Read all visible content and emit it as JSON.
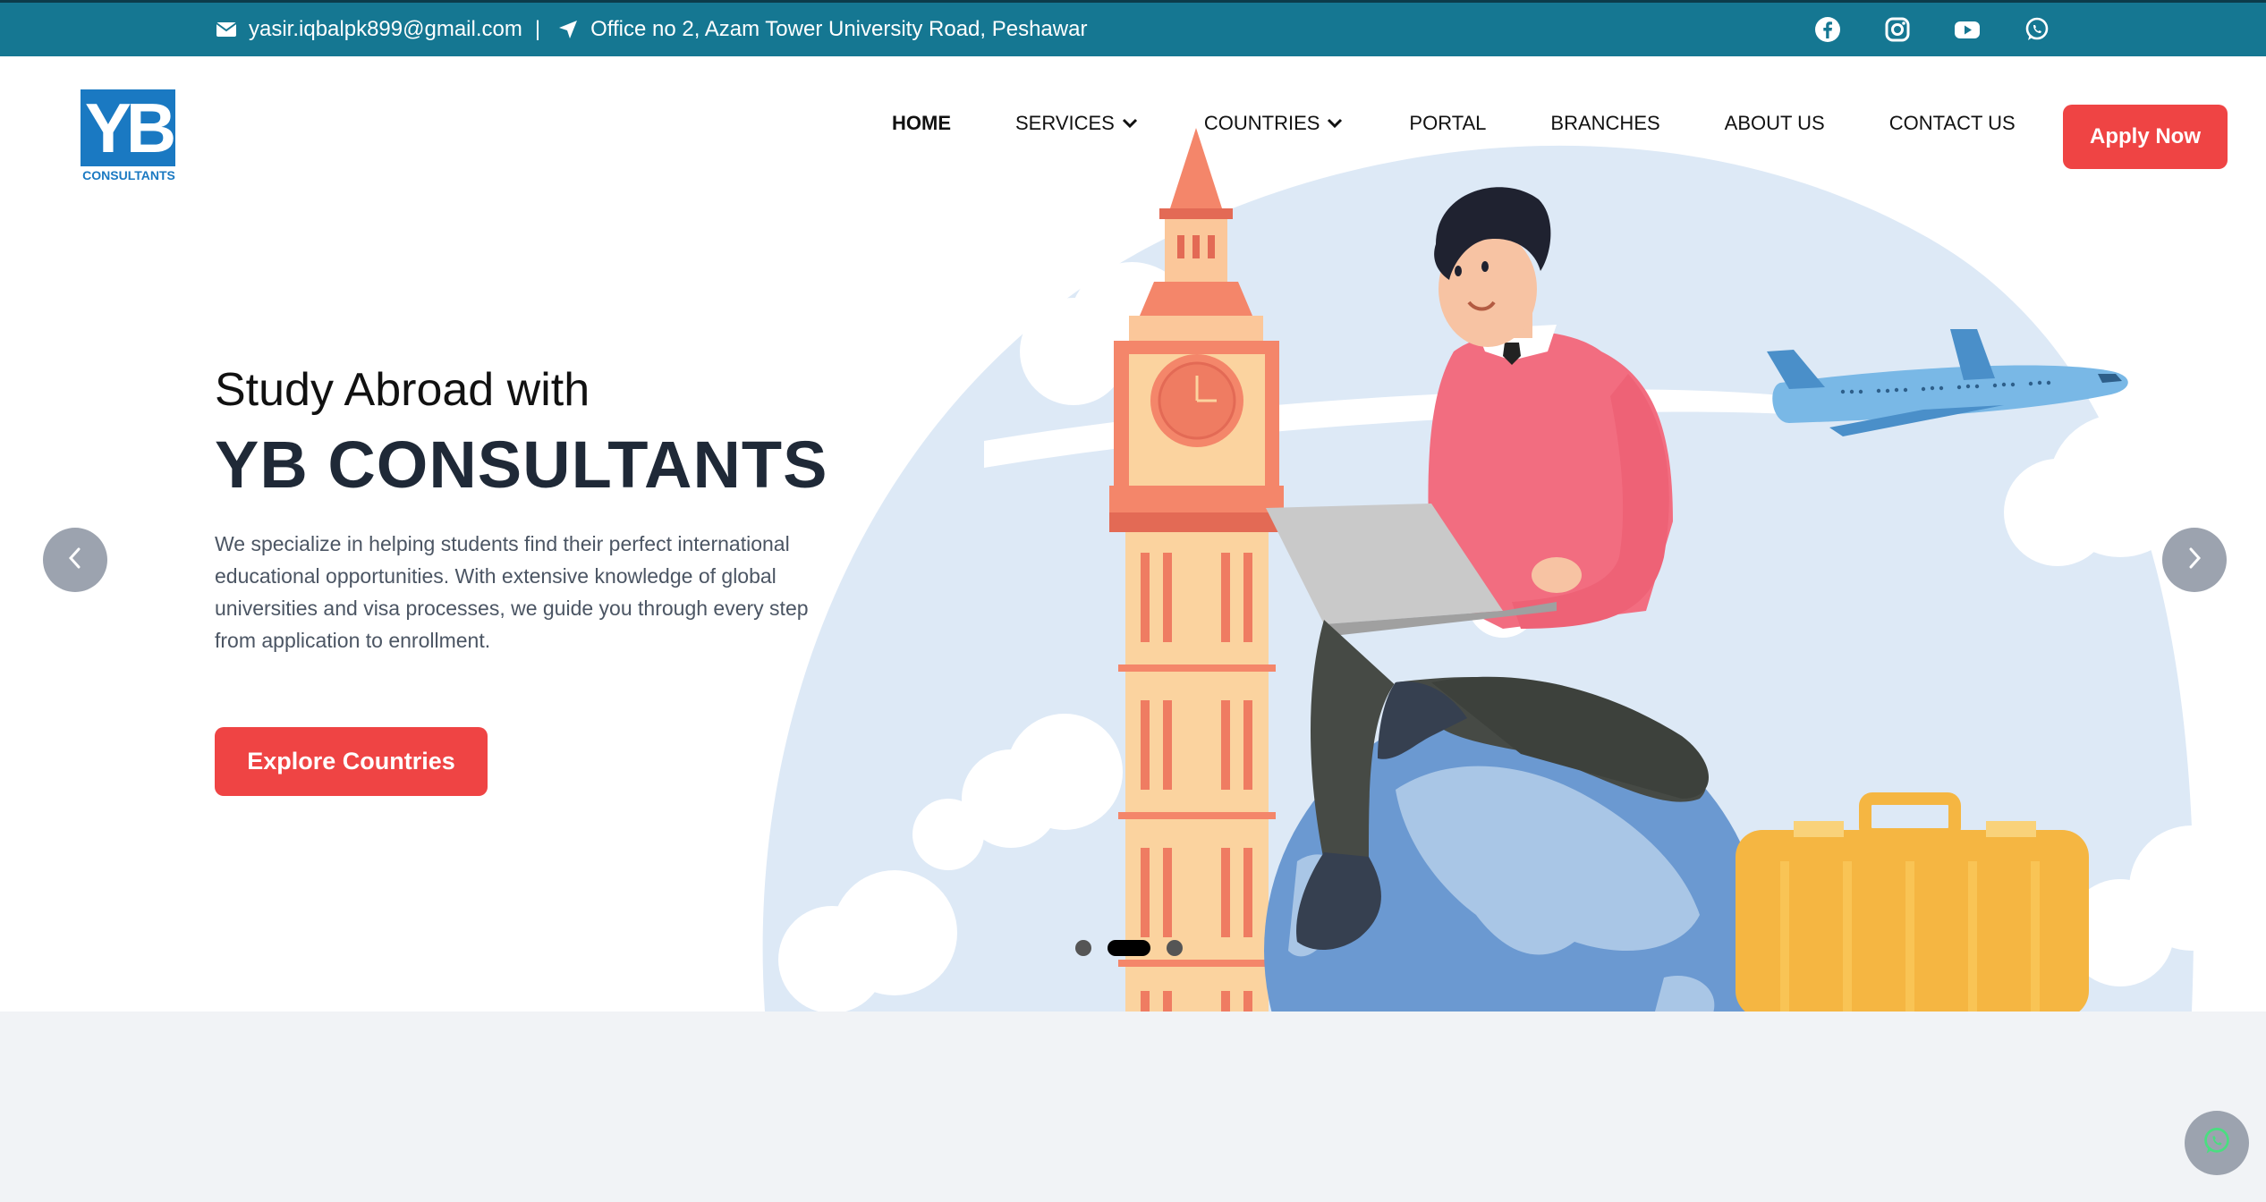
{
  "topbar": {
    "email": "yasir.iqbalpk899@gmail.com",
    "separator": "|",
    "address": "Office no 2, Azam Tower University Road, Peshawar",
    "icons": [
      "envelope-icon",
      "location-arrow-icon",
      "facebook-icon",
      "instagram-icon",
      "youtube-icon",
      "whatsapp-icon"
    ]
  },
  "header": {
    "logo_text": "YB",
    "logo_subtext": "CONSULTANTS",
    "nav": [
      "HOME",
      "SERVICES",
      "COUNTRIES",
      "PORTAL",
      "BRANCHES",
      "ABOUT US",
      "CONTACT US"
    ],
    "apply_label": "Apply Now"
  },
  "hero": {
    "subtitle": "Study Abroad with",
    "title": "YB CONSULTANTS",
    "description": "We specialize in helping students find their perfect international educational opportunities. With extensive knowledge of global universities and visa processes, we guide you through every step from application to enrollment.",
    "cta_label": "Explore Countries",
    "slides_total": 3,
    "active_slide": 2
  },
  "colors": {
    "topbar": "#157792",
    "accent": "#ef4444",
    "logo": "#1a79c2"
  }
}
